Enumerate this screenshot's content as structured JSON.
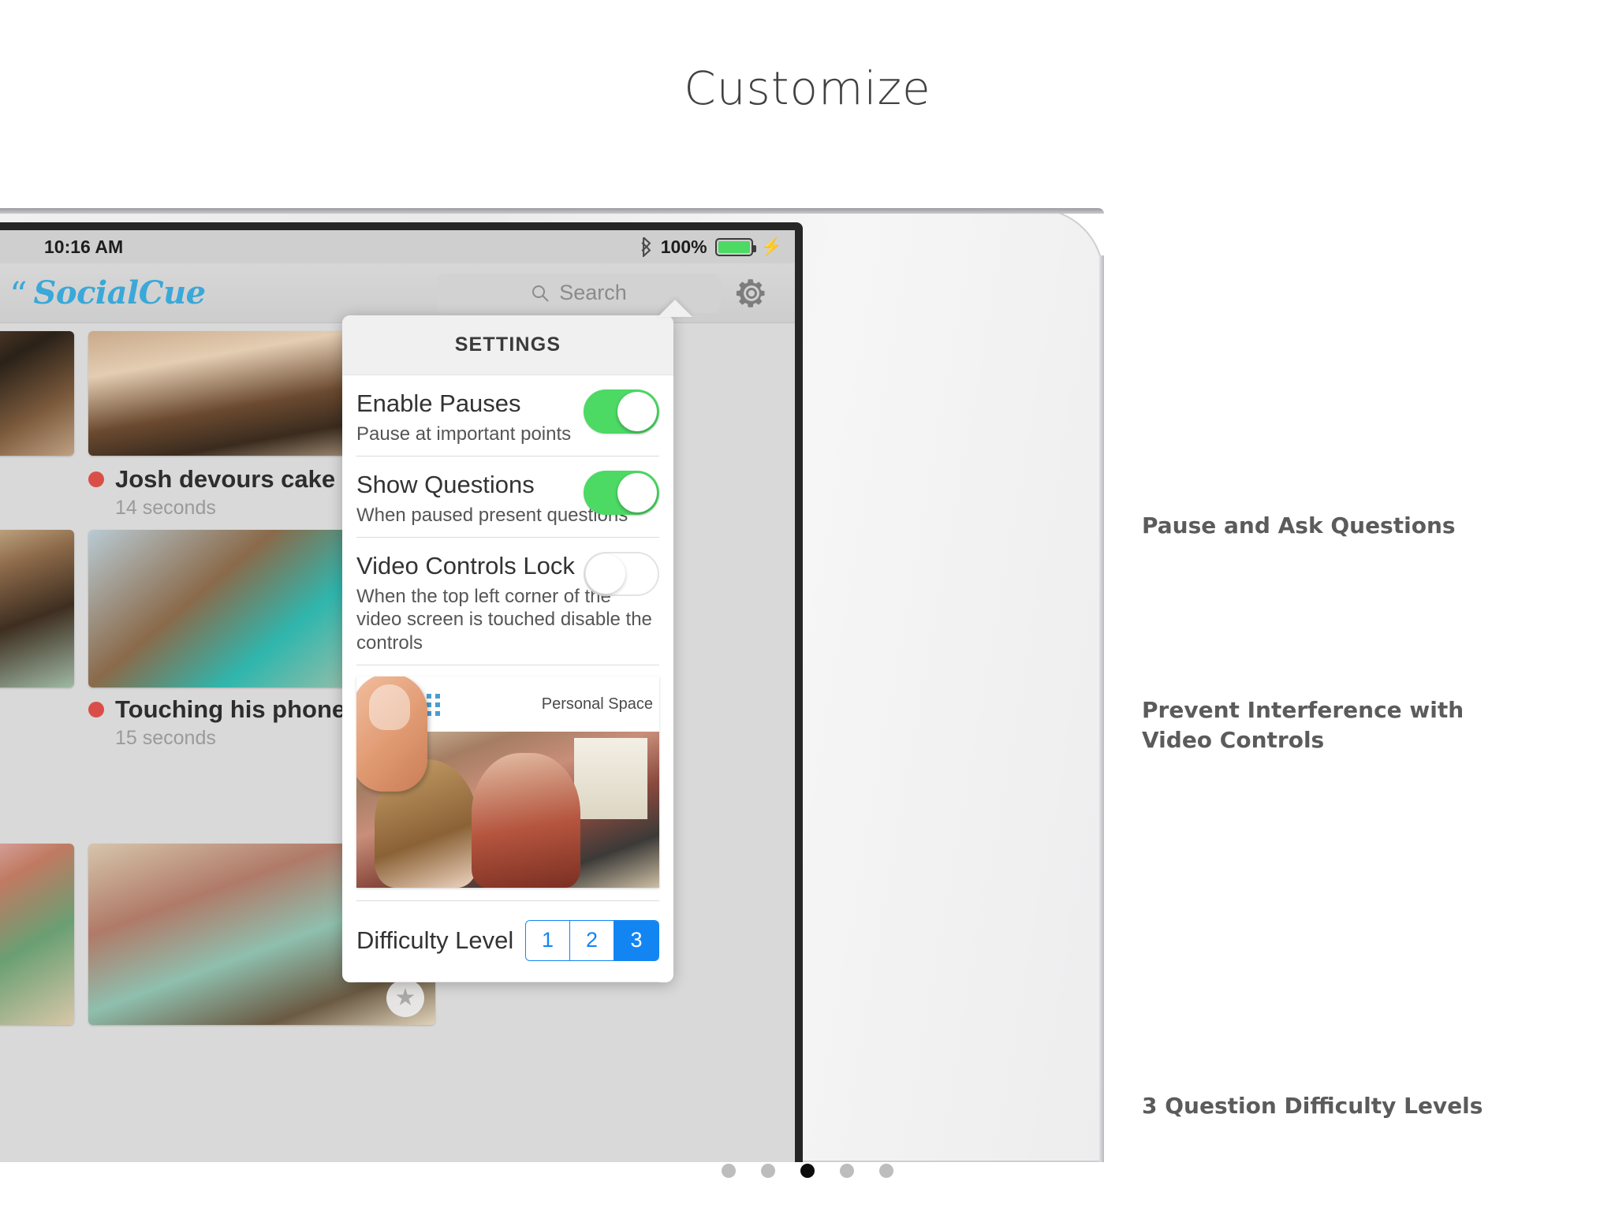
{
  "page": {
    "title": "Customize"
  },
  "device": {
    "status_bar": {
      "time": "10:16 AM",
      "bluetooth_icon": "bluetooth-icon",
      "battery_percent": "100%",
      "charging_icon": "lightning-bolt-icon"
    },
    "nav_bar": {
      "logo_quote": "“",
      "logo_text": "SocialCue",
      "search_placeholder": "Search",
      "search_icon": "search-icon",
      "gear_icon": "gear-icon"
    }
  },
  "video_list": [
    {
      "title": "Josh devours cake",
      "duration": "14 seconds",
      "status_dot_color": "#d94f48",
      "star_icon": "star-icon"
    },
    {
      "title": "Touching his phone",
      "duration": "15 seconds",
      "status_dot_color": "#d94f48",
      "star_icon": "star-icon"
    }
  ],
  "settings_popover": {
    "header": "SETTINGS",
    "rows": [
      {
        "title": "Enable Pauses",
        "subtitle": "Pause at important points",
        "toggle": "on"
      },
      {
        "title": "Show Questions",
        "subtitle": "When paused present questions",
        "toggle": "on"
      },
      {
        "title": "Video Controls Lock",
        "subtitle": "When the top left corner of the\nvideo screen is touched disable the controls",
        "toggle": "off"
      }
    ],
    "preview": {
      "grid_icon": "grid-3x3-icon",
      "caption": "Personal Space",
      "finger_icon": "thumb-touch-icon"
    },
    "difficulty": {
      "label": "Difficulty Level",
      "options": [
        "1",
        "2",
        "3"
      ],
      "selected": "3",
      "accent_color": "#1285f2"
    }
  },
  "annotations": [
    {
      "text": "Pause and Ask Questions"
    },
    {
      "text": "Prevent Interference with\nVideo Controls"
    },
    {
      "text": "3 Question Difficulty Levels"
    }
  ],
  "pagination": {
    "count": 5,
    "active_index": 2
  },
  "colors": {
    "toggle_on": "#4cd964",
    "accent_blue": "#1285f2",
    "brand_blue": "#3aa8d8",
    "status_dot": "#d94f48"
  }
}
